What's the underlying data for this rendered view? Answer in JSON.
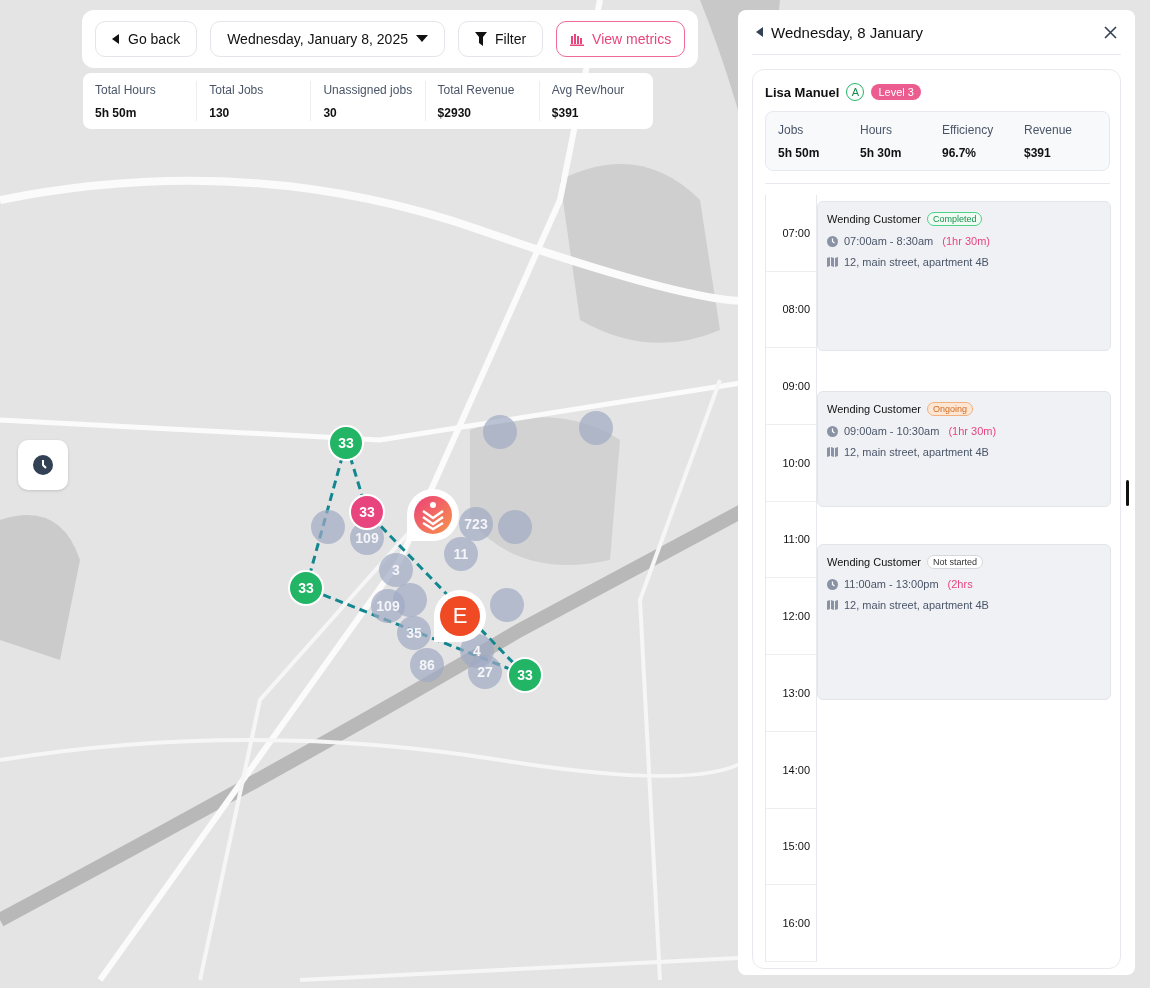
{
  "toolbar": {
    "back": "Go back",
    "date": "Wednesday, January 8, 2025",
    "filter": "Filter",
    "metrics": "View metrics"
  },
  "stats": [
    {
      "label": "Total Hours",
      "value": "5h 50m"
    },
    {
      "label": "Total Jobs",
      "value": "130"
    },
    {
      "label": "Unassigned jobs",
      "value": "30"
    },
    {
      "label": "Total Revenue",
      "value": "$2930"
    },
    {
      "label": "Avg Rev/hour",
      "value": "$391"
    }
  ],
  "markers": [
    {
      "kind": "cluster"
    },
    {
      "kind": "cluster"
    },
    {
      "kind": "cluster"
    },
    {
      "kind": "cluster"
    },
    {
      "kind": "cluster"
    },
    {
      "kind": "cluster"
    },
    {
      "kind": "cluster",
      "label": "109"
    },
    {
      "kind": "cluster",
      "label": "723"
    },
    {
      "kind": "cluster",
      "label": "11"
    },
    {
      "kind": "cluster",
      "label": "3"
    },
    {
      "kind": "cluster",
      "label": "109"
    },
    {
      "kind": "cluster",
      "label": "35"
    },
    {
      "kind": "cluster",
      "label": "86"
    },
    {
      "kind": "cluster",
      "label": "4"
    },
    {
      "kind": "cluster",
      "label": "27"
    },
    {
      "kind": "stop",
      "label": "33"
    },
    {
      "kind": "current",
      "label": "33"
    },
    {
      "kind": "stop",
      "label": "33"
    },
    {
      "kind": "stop",
      "label": "33"
    },
    {
      "kind": "logo"
    },
    {
      "kind": "letter",
      "label": "E"
    }
  ],
  "panel": {
    "title": "Wednesday, 8 January",
    "worker": {
      "name": "Lisa Manuel",
      "grade": "A",
      "level": "Level 3"
    },
    "stats": [
      {
        "label": "Jobs",
        "value": "5h 50m"
      },
      {
        "label": "Hours",
        "value": "5h 30m"
      },
      {
        "label": "Efficiency",
        "value": "96.7%"
      },
      {
        "label": "Revenue",
        "value": "$391"
      }
    ],
    "hours": [
      "07:00",
      "08:00",
      "09:00",
      "10:00",
      "11:00",
      "12:00",
      "13:00",
      "14:00",
      "15:00",
      "16:00"
    ],
    "jobs": [
      {
        "customer": "Wending Customer",
        "status": "Completed",
        "kind": "completed",
        "time": "07:00am - 8:30am",
        "duration": "(1hr 30m)",
        "address": "12, main street, apartment 4B"
      },
      {
        "customer": "Wending Customer",
        "status": "Ongoing",
        "kind": "ongoing",
        "time": "09:00am - 10:30am",
        "duration": "(1hr 30m)",
        "address": "12, main street, apartment 4B"
      },
      {
        "customer": "Wending Customer",
        "status": "Not started",
        "kind": "pending",
        "time": "11:00am - 13:00pm",
        "duration": "(2hrs",
        "address": "12, main street, apartment 4B"
      }
    ]
  }
}
